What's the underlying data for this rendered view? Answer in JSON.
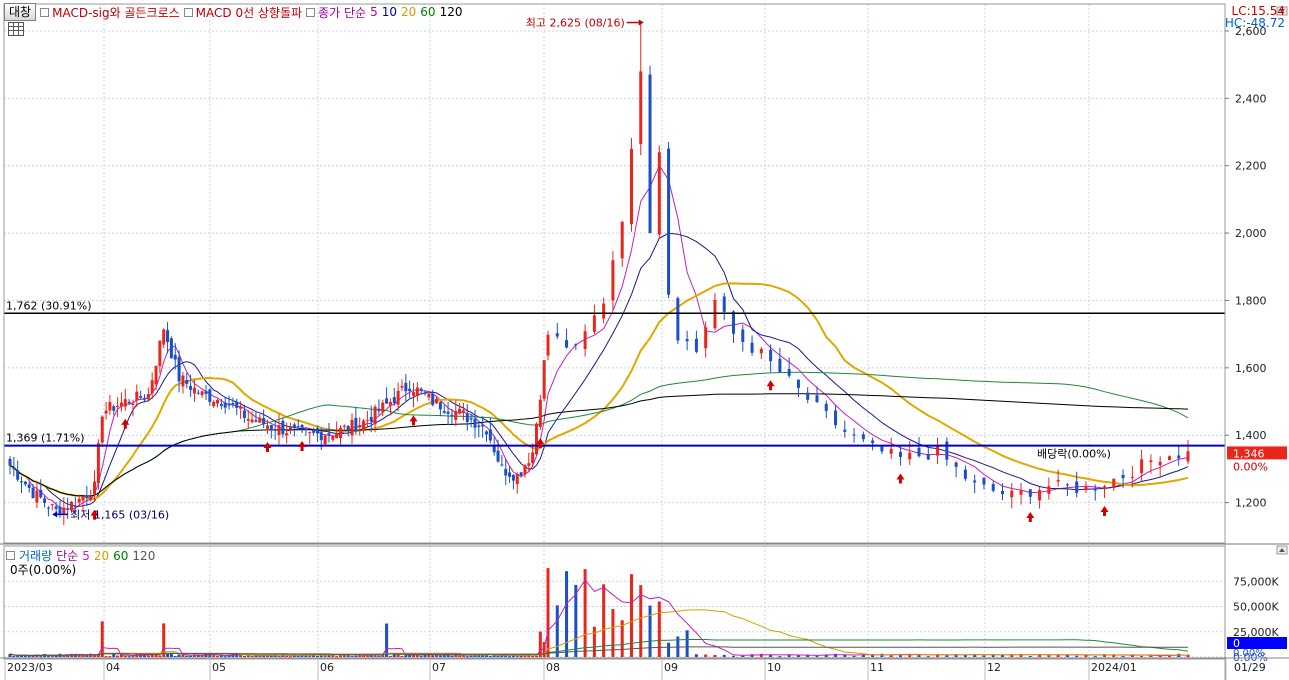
{
  "toolbar": {
    "toggle_label": "대창",
    "indicators": [
      {
        "label": "MACD-sig와 골든크로스",
        "color": "#c00000"
      },
      {
        "label": "MACD 0선 상향돌파",
        "color": "#c00000"
      },
      {
        "label": "종가 단순",
        "color": "#a000a0"
      }
    ],
    "ma_periods": [
      {
        "label": "5",
        "color": "#b000b0"
      },
      {
        "label": "10",
        "color": "#0000b0"
      },
      {
        "label": "20",
        "color": "#d4a000"
      },
      {
        "label": "60",
        "color": "#008000"
      },
      {
        "label": "120",
        "color": "#000000"
      }
    ]
  },
  "header_right": {
    "lc": "LC:15.54",
    "hc": "HC:-48.72"
  },
  "colors": {
    "up": "#e8261c",
    "down": "#1a4fc8",
    "ma5": "#c020c0",
    "ma10": "#1a1a8c",
    "ma20": "#e0a800",
    "ma60": "#1e8a3a",
    "ma120": "#000000",
    "hline_black": "#000000",
    "hline_blue": "#0000c0",
    "price_tag": "#e8261c",
    "vol_tag": "#0000ff"
  },
  "annotations": {
    "high": "최고 2,625 (08/16)",
    "low": "최저 1,165 (03/16)",
    "level_high": "1,762 (30.91%)",
    "level_mid": "1,369 (1.71%)",
    "dividend": "배당락(0.00%)",
    "price_tag": "1,346",
    "price_pct": "0.00%",
    "vol_tag": "0",
    "vol_pct": "0.00%"
  },
  "volume_panel": {
    "title": "거래량",
    "ma_label": "단순",
    "periods": [
      {
        "label": "5",
        "color": "#c020c0"
      },
      {
        "label": "20",
        "color": "#d4a000"
      },
      {
        "label": "60",
        "color": "#008000"
      },
      {
        "label": "120",
        "color": "#555555"
      }
    ],
    "sub": "0주(0.00%)"
  },
  "chart_data": [
    {
      "type": "candlestick",
      "title": "",
      "x": [
        "2023/03",
        "04",
        "05",
        "06",
        "07",
        "08",
        "09",
        "10",
        "11",
        "12",
        "2024/01",
        "01/29"
      ],
      "ylim": [
        1080,
        2680
      ],
      "yticks": [
        1200,
        1400,
        1600,
        1800,
        2000,
        2200,
        2400,
        2600
      ],
      "ytick_labels": [
        "1,200",
        "1,400",
        "1,600",
        "1,800",
        "2,000",
        "2,200",
        "2,400",
        "2,600"
      ],
      "levels": [
        1762,
        1369
      ],
      "last_price": 1346,
      "high": 2625,
      "low": 1165,
      "grid": true
    },
    {
      "type": "bar",
      "title": "거래량",
      "x": [
        "2023/03",
        "04",
        "05",
        "06",
        "07",
        "08",
        "09",
        "10",
        "11",
        "12",
        "2024/01",
        "01/29"
      ],
      "ylim": [
        0,
        100000
      ],
      "yticks": [
        0,
        25000,
        50000,
        75000
      ],
      "ytick_labels": [
        "0.00%",
        "25,000K",
        "50,000K",
        "75,000K"
      ],
      "last_value": 0,
      "grid": true
    }
  ]
}
